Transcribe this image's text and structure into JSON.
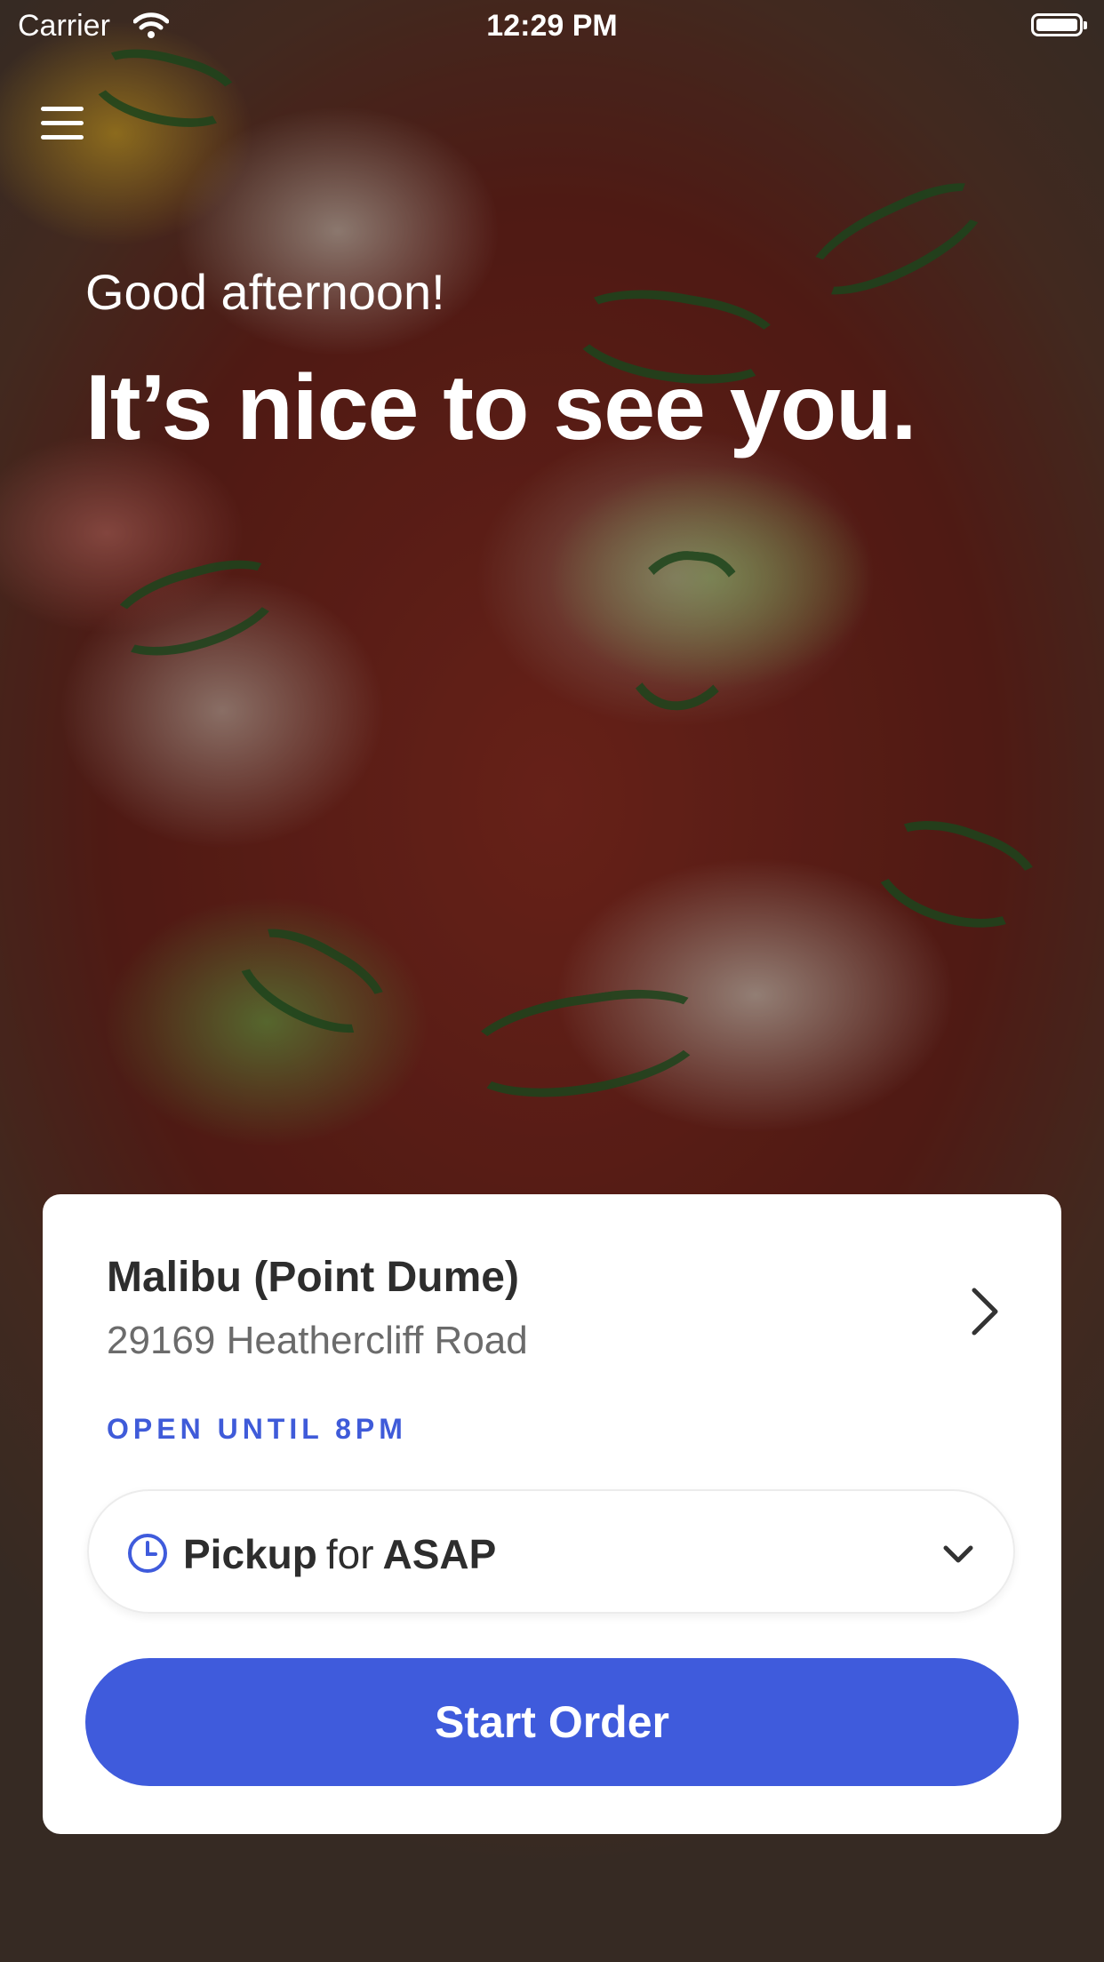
{
  "status_bar": {
    "carrier": "Carrier",
    "time": "12:29 PM",
    "icons": [
      "wifi-icon",
      "battery-icon"
    ]
  },
  "header": {
    "menu_icon": "hamburger-menu-icon",
    "greeting": "Good afternoon!",
    "headline": "It’s nice to see you."
  },
  "location_card": {
    "name": "Malibu (Point Dume)",
    "address": "29169 Heathercliff Road",
    "open_status": "OPEN UNTIL 8PM",
    "chevron_icon": "chevron-right-icon",
    "order_mode": {
      "icon": "clock-icon",
      "mode": "Pickup",
      "connector": "for",
      "time": "ASAP",
      "dropdown_icon": "chevron-down-icon"
    },
    "start_button": "Start Order"
  },
  "colors": {
    "accent": "#3f5bdc",
    "open_status": "#3f5bd9",
    "card_background": "#ffffff"
  }
}
